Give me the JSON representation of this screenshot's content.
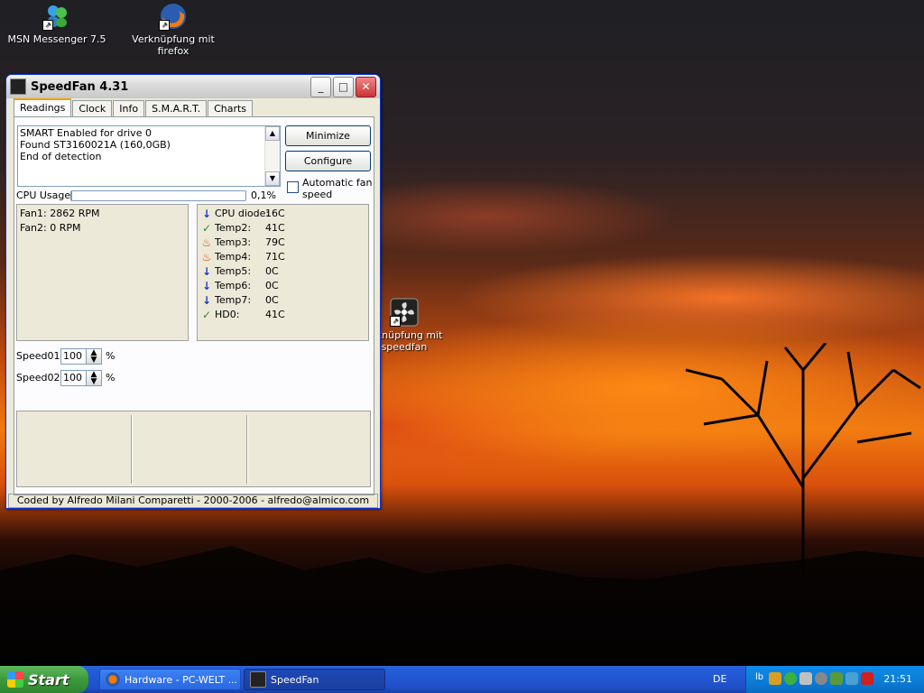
{
  "desktop": {
    "icons": [
      {
        "label": "MSN Messenger 7.5"
      },
      {
        "label": "Verknüpfung mit firefox"
      },
      {
        "label": "erknüpfung mit speedfan"
      }
    ]
  },
  "window": {
    "title": "SpeedFan 4.31",
    "tabs": [
      "Readings",
      "Clock",
      "Info",
      "S.M.A.R.T.",
      "Charts"
    ],
    "log_lines": [
      "SMART Enabled for drive 0",
      "Found ST3160021A (160,0GB)",
      "End of detection"
    ],
    "buttons": {
      "minimize": "Minimize",
      "configure": "Configure"
    },
    "auto_fan_label": "Automatic fan speed",
    "cpu_usage": {
      "label": "CPU Usage",
      "value": "0,1%",
      "fraction": 0.001
    },
    "fans": [
      "Fan1: 2862 RPM",
      "Fan2: 0 RPM"
    ],
    "temps": [
      {
        "name": "CPU diode:",
        "value": "16C",
        "status": "down-arrow-icon"
      },
      {
        "name": "Temp2:",
        "value": "41C",
        "status": "check-icon"
      },
      {
        "name": "Temp3:",
        "value": "79C",
        "status": "flame-icon"
      },
      {
        "name": "Temp4:",
        "value": "71C",
        "status": "flame-icon"
      },
      {
        "name": "Temp5:",
        "value": "0C",
        "status": "down-arrow-icon"
      },
      {
        "name": "Temp6:",
        "value": "0C",
        "status": "down-arrow-icon"
      },
      {
        "name": "Temp7:",
        "value": "0C",
        "status": "down-arrow-icon"
      },
      {
        "name": "HD0:",
        "value": "41C",
        "status": "check-icon"
      }
    ],
    "speeds": [
      {
        "label": "Speed01:",
        "value": "100",
        "unit": "%"
      },
      {
        "label": "Speed02:",
        "value": "100",
        "unit": "%"
      }
    ],
    "footer": "Coded by Alfredo Milani Comparetti - 2000-2006 - alfredo@almico.com"
  },
  "taskbar": {
    "start_label": "Start",
    "tasks": [
      {
        "label": "Hardware - PC-WELT ..."
      },
      {
        "label": "SpeedFan"
      }
    ],
    "language": "DE",
    "tray_first": "lb",
    "clock": "21:51"
  },
  "colors": {
    "title_bar": "#dcdcdc",
    "taskbar": "#245edb",
    "start_button": "#3b9a3b",
    "cpu_bar_fill": "#2ed12e"
  }
}
